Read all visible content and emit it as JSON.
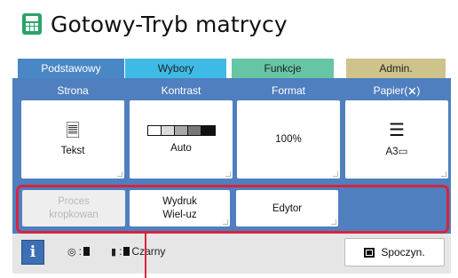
{
  "header": {
    "title": "Gotowy-Tryb matrycy",
    "icon": "master-mode-icon"
  },
  "tabs": [
    {
      "label": "Podstawowy",
      "color": "#4a87c5",
      "active": true
    },
    {
      "label": "Wybory",
      "color": "#3dbbe6"
    },
    {
      "label": "Funkcje",
      "color": "#66c5a4"
    },
    {
      "label": "Admin.",
      "color": "#cfc38c"
    }
  ],
  "settings": [
    {
      "label": "Strona",
      "value": "Tekst",
      "icon": "text-document-icon"
    },
    {
      "label": "Kontrast",
      "value": "Auto",
      "icon": "contrast-scale-icon"
    },
    {
      "label": "Format",
      "value": "100%"
    },
    {
      "label": "Papier(⌥)",
      "value": "A3",
      "icon": "paper-stack-icon"
    }
  ],
  "row2": [
    {
      "label": "Proces kropkowan",
      "disabled": true
    },
    {
      "label": "Wydruk Wiel-uz"
    },
    {
      "label": "Edytor"
    }
  ],
  "status": {
    "info_label": "i",
    "ink_color": "Czarny",
    "sleep_label": "Spoczyn."
  },
  "colors": {
    "panel": "#4f7fbe",
    "highlight": "#d6253e"
  }
}
